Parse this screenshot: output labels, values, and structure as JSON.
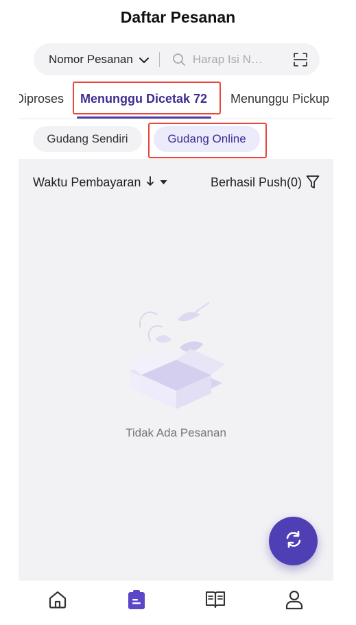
{
  "header": {
    "title": "Daftar Pesanan"
  },
  "search": {
    "type_label": "Nomor Pesanan",
    "placeholder": "Harap Isi N…",
    "icons": {
      "type_toggle": "chevron-down-icon",
      "search": "search-icon",
      "scan": "scan-icon"
    }
  },
  "tabs": [
    {
      "label": "Diproses",
      "active": false
    },
    {
      "label": "Menunggu Dicetak 72",
      "active": true
    },
    {
      "label": "Menunggu Pickup",
      "active": false
    }
  ],
  "warehouse_chips": [
    {
      "label": "Gudang Sendiri",
      "active": false
    },
    {
      "label": "Gudang Online",
      "active": true
    }
  ],
  "sort_bar": {
    "sort_label": "Waktu Pembayaran",
    "sort_direction_icon": "arrow-down-icon",
    "push_label": "Berhasil Push(0)",
    "filter_icon": "filter-icon"
  },
  "empty_state": {
    "text": "Tidak Ada Pesanan",
    "illustration": "empty-box-illustration"
  },
  "fab": {
    "icon": "refresh-icon"
  },
  "bottom_nav": [
    {
      "icon": "home-icon",
      "active": false
    },
    {
      "icon": "orders-icon",
      "active": true
    },
    {
      "icon": "book-icon",
      "active": false
    },
    {
      "icon": "user-icon",
      "active": false
    }
  ],
  "colors": {
    "accent": "#4f3fb5",
    "active_tab_text": "#3d2d8f",
    "highlight_box": "#e8453c",
    "content_bg": "#f2f2f5"
  }
}
